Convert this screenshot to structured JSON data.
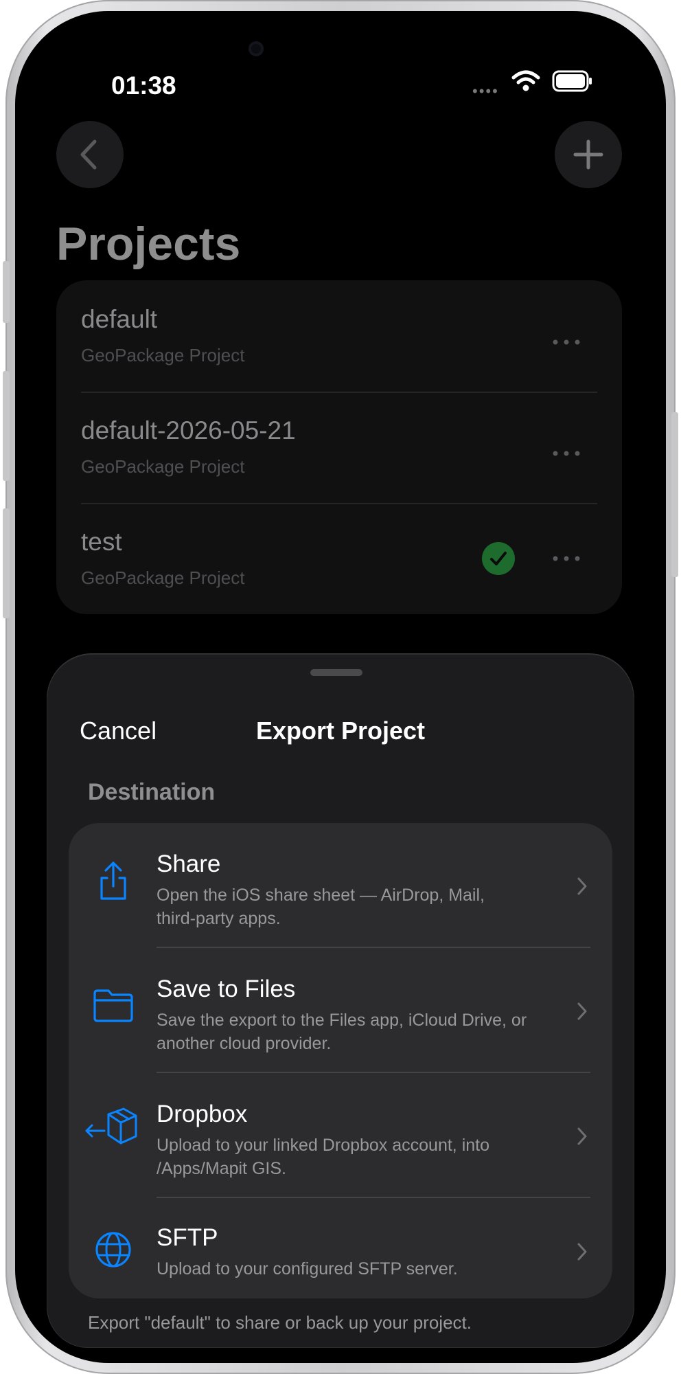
{
  "status_bar": {
    "time": "01:38",
    "signal": "••••"
  },
  "header": {
    "title": "Projects"
  },
  "projects": [
    {
      "name": "default",
      "type": "GeoPackage Project",
      "active": false
    },
    {
      "name": "default-2026-05-21",
      "type": "GeoPackage Project",
      "active": false
    },
    {
      "name": "test",
      "type": "GeoPackage Project",
      "active": true
    }
  ],
  "sheet": {
    "cancel_label": "Cancel",
    "title": "Export Project",
    "section_label": "Destination",
    "destinations": [
      {
        "title": "Share",
        "description": "Open the iOS share sheet — AirDrop, Mail, third-party apps.",
        "icon": "share-icon"
      },
      {
        "title": "Save to Files",
        "description": "Save the export to the Files app, iCloud Drive, or another cloud provider.",
        "icon": "folder-icon"
      },
      {
        "title": "Dropbox",
        "description": "Upload to your linked Dropbox account, into /Apps/Mapit GIS.",
        "icon": "dropbox-box-icon"
      },
      {
        "title": "SFTP",
        "description": "Upload to your configured SFTP server.",
        "icon": "globe-icon"
      }
    ],
    "footer": "Export \"default\" to share or back up your project."
  },
  "colors": {
    "accent": "#0a84ff",
    "success": "#1e6b2e",
    "background": "#000000",
    "sheet": "#1c1c1e",
    "card": "#2c2c2e"
  }
}
